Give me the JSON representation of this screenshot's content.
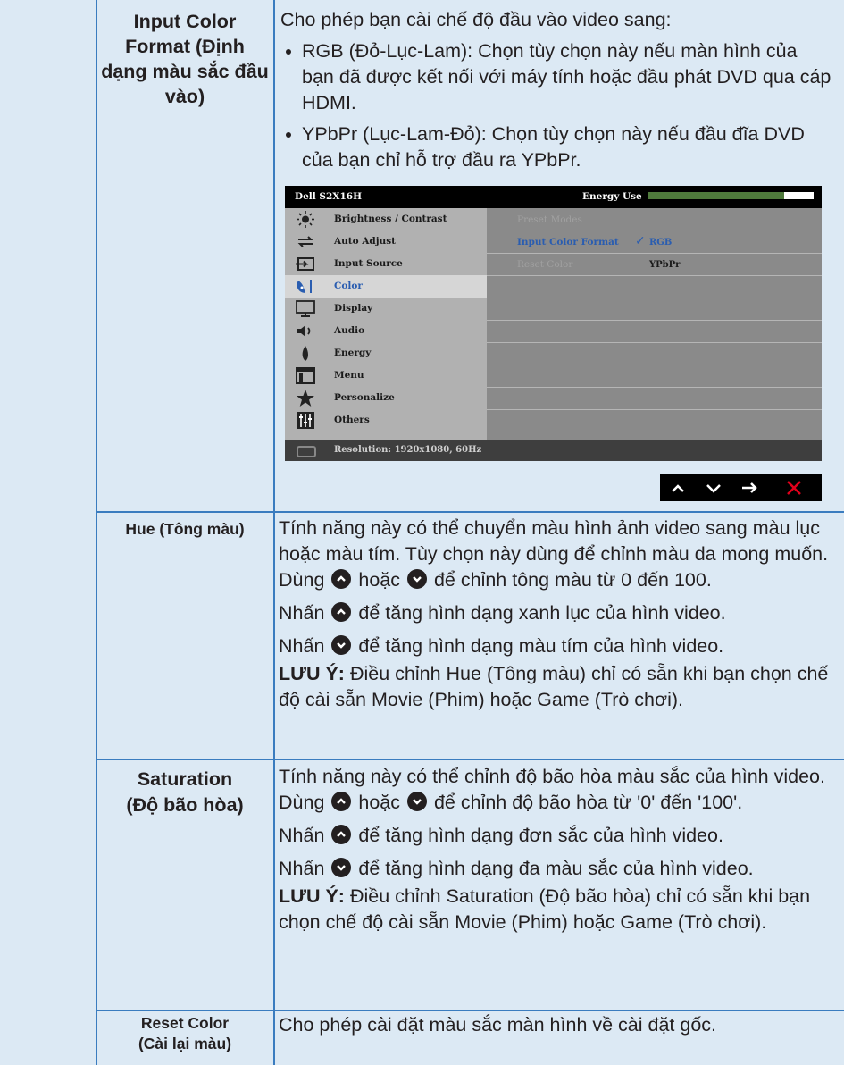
{
  "rows": [
    {
      "label": "Input Color Format (Định dạng màu sắc đầu vào)",
      "intro": "Cho phép bạn cài chế độ đầu vào video sang:",
      "bullets": [
        "RGB (Đỏ-Lục-Lam): Chọn tùy chọn này nếu màn hình của bạn đã được kết nối với máy tính hoặc đầu phát DVD qua cáp HDMI.",
        "YPbPr (Lục-Lam-Đỏ): Chọn tùy chọn này nếu đầu đĩa DVD của bạn chỉ hỗ trợ đầu ra YPbPr."
      ]
    },
    {
      "label": "Hue (Tông màu)",
      "p1_a": "Tính năng này có thể chuyển màu hình ảnh video sang màu lục hoặc màu tím. Tùy chọn này dùng để chỉnh màu da mong muốn. Dùng",
      "p1_b": "hoặc",
      "p1_c": "để chỉnh tông màu từ 0 đến 100.",
      "p2_a": "Nhấn",
      "p2_b": "để tăng hình dạng xanh lục của hình video.",
      "p3_a": "Nhấn",
      "p3_b": "để tăng hình dạng màu tím của hình video.",
      "note_label": "LƯU Ý:",
      "note_text": "Điều chỉnh Hue (Tông màu) chỉ có sẵn khi bạn chọn chế độ cài sẵn Movie (Phim) hoặc Game (Trò chơi)."
    },
    {
      "label_1": "Saturation",
      "label_2": "(Độ bão hòa)",
      "p1_a": "Tính năng này có thể chỉnh độ bão hòa màu sắc của hình video. Dùng",
      "p1_b": "hoặc",
      "p1_c": "để chỉnh độ bão hòa từ '0' đến '100'.",
      "p2_a": "Nhấn",
      "p2_b": "để tăng hình dạng đơn sắc của hình video.",
      "p3_a": "Nhấn",
      "p3_b": "để tăng hình dạng đa màu sắc của hình video.",
      "note_label": "LƯU Ý:",
      "note_text": "Điều chỉnh Saturation (Độ bão hòa) chỉ có sẵn khi bạn chọn chế độ cài sẵn Movie (Phim) hoặc Game (Trò chơi)."
    },
    {
      "label_1": "Reset Color",
      "label_2": "(Cài lại màu)",
      "text": "Cho phép cài đặt màu sắc màn hình về cài đặt gốc."
    }
  ],
  "osd": {
    "model": "Dell S2X16H",
    "energy_label": "Energy Use",
    "energy_level": 0.82,
    "menu": [
      {
        "label": "Brightness / Contrast",
        "icon": "brightness-icon"
      },
      {
        "label": "Auto Adjust",
        "icon": "auto-adjust-icon"
      },
      {
        "label": "Input Source",
        "icon": "input-source-icon"
      },
      {
        "label": "Color",
        "icon": "color-icon",
        "selected": true
      },
      {
        "label": "Display",
        "icon": "display-icon"
      },
      {
        "label": "Audio",
        "icon": "audio-icon"
      },
      {
        "label": "Energy",
        "icon": "energy-icon"
      },
      {
        "label": "Menu",
        "icon": "menu-icon"
      },
      {
        "label": "Personalize",
        "icon": "personalize-icon"
      },
      {
        "label": "Others",
        "icon": "others-icon"
      }
    ],
    "submenu": {
      "preset_modes": "Preset Modes",
      "input_color_format": "Input Color Format",
      "reset_color": "Reset Color",
      "rgb": "RGB",
      "ypbpr": "YPbPr"
    },
    "resolution": "Resolution: 1920x1080, 60Hz",
    "nav_buttons": [
      "up",
      "down",
      "enter",
      "close"
    ]
  },
  "colors": {
    "rule": "#3a7cbf",
    "background": "#dce9f4",
    "close_x": "#e0001b"
  }
}
